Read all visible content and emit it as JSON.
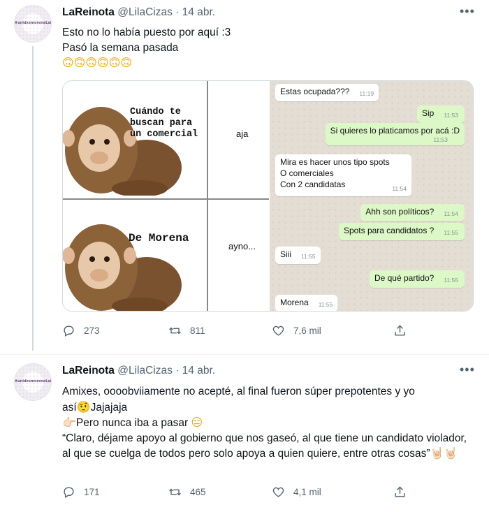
{
  "tweets": [
    {
      "author": {
        "name": "LaReinota",
        "handle": "@LilaCizas",
        "separator": "·",
        "date": "14 abr.",
        "avatar_text": "#unidxsmorenaLaLilaE"
      },
      "text_lines": [
        "Esto no lo había puesto por aquí :3",
        "Pasó la semana pasada"
      ],
      "emojis": "🙃🙃🙃🙃🙃🙃",
      "more_icon": "more-horizontal-icon",
      "media": {
        "meme": {
          "caption_top": "Cuándo te\nbuscan para\nun comercial",
          "reply_top": "aja",
          "caption_bottom": "De Morena",
          "reply_bottom": "ayno..."
        },
        "chat": [
          {
            "dir": "in",
            "text": "Estas ocupada???",
            "time": "11:19"
          },
          {
            "dir": "out",
            "text": "Sip",
            "time": "11:53"
          },
          {
            "dir": "out",
            "text": "Si quieres lo platicamos por acá :D",
            "time": "11:53"
          },
          {
            "dir": "in",
            "lines": [
              "Mira es hacer unos tipo spots",
              "O comerciales",
              "Con 2 candidatas"
            ],
            "time": "11:54"
          },
          {
            "dir": "out",
            "text": "Ahh son políticos?",
            "time": "11:54"
          },
          {
            "dir": "out",
            "text": "Spots para candidatos ?",
            "time": "11:55"
          },
          {
            "dir": "in",
            "text": "Siii",
            "time": "11:55"
          },
          {
            "dir": "out",
            "text": "De qué partido?",
            "time": "11:55"
          },
          {
            "dir": "in",
            "text": "Morena",
            "time": "11:55"
          }
        ],
        "tick_glyph": "✓✓"
      },
      "actions": {
        "replies": "273",
        "retweets": "811",
        "likes": "7,6 mil"
      }
    },
    {
      "author": {
        "name": "LaReinota",
        "handle": "@LilaCizas",
        "separator": "·",
        "date": "14 abr.",
        "avatar_text": "#unidxsmorenaLaLilaE"
      },
      "text_line1": "Amixes, oooobviiamente no acepté, al final fueron súper prepotentes y yo",
      "text_line2_prefix": "así",
      "text_line2_emoji": "🤨",
      "text_line2_suffix": "Jajajaja",
      "text_line3_emoji": "👉🏻",
      "text_line3": "Pero nunca iba a pasar ",
      "text_line3_emoji2": "😑",
      "text_quote": "“Claro, déjame apoyo al gobierno que nos gaseó, al que tiene un candidato violador, al que se cuelga de todos pero solo apoya a quien quiere, entre otras cosas”",
      "text_quote_emoji": "🤘🏻🤘🏻",
      "more_icon": "more-horizontal-icon",
      "actions": {
        "replies": "171",
        "retweets": "465",
        "likes": "4,1 mil"
      }
    }
  ],
  "colors": {
    "text": "#0f1419",
    "secondary": "#536471",
    "chat_out": "#dcf8c6",
    "chat_in": "#ffffff",
    "chat_bg": "#e4ddd4",
    "read_ticks": "#4fb6ec"
  }
}
